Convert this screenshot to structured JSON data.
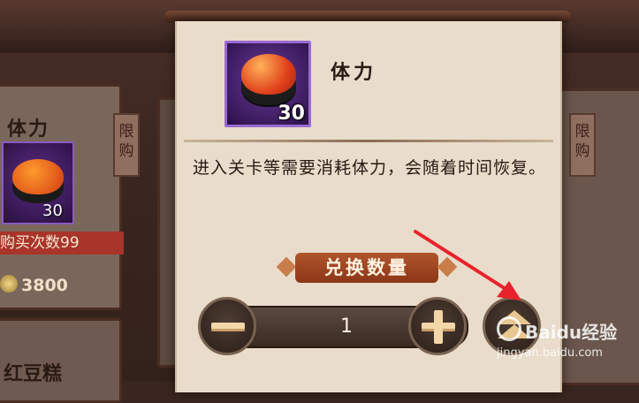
{
  "background_shop": {
    "item_title": "体力",
    "item_count": "30",
    "limit_tag": "限购",
    "buy_count": "购买次数99",
    "price": "3800",
    "bottom_item_title": "红豆糕"
  },
  "dialog": {
    "item": {
      "name": "体力",
      "count": "30",
      "icon": "sushi-icon"
    },
    "description": "进入关卡等需要消耗体力，会随着时间恢复。",
    "quantity_label": "兑换数量",
    "quantity_value": "1",
    "minus_icon": "minus-icon",
    "plus_icon": "plus-icon",
    "max_icon": "max-chevron-icon"
  },
  "watermark": {
    "brand": "Baidu经验",
    "url": "jingyan.baidu.com"
  },
  "colors": {
    "annotation_arrow": "#e8222a",
    "quantity_banner": "#a2461f",
    "panel_background": "#e9dccb"
  }
}
